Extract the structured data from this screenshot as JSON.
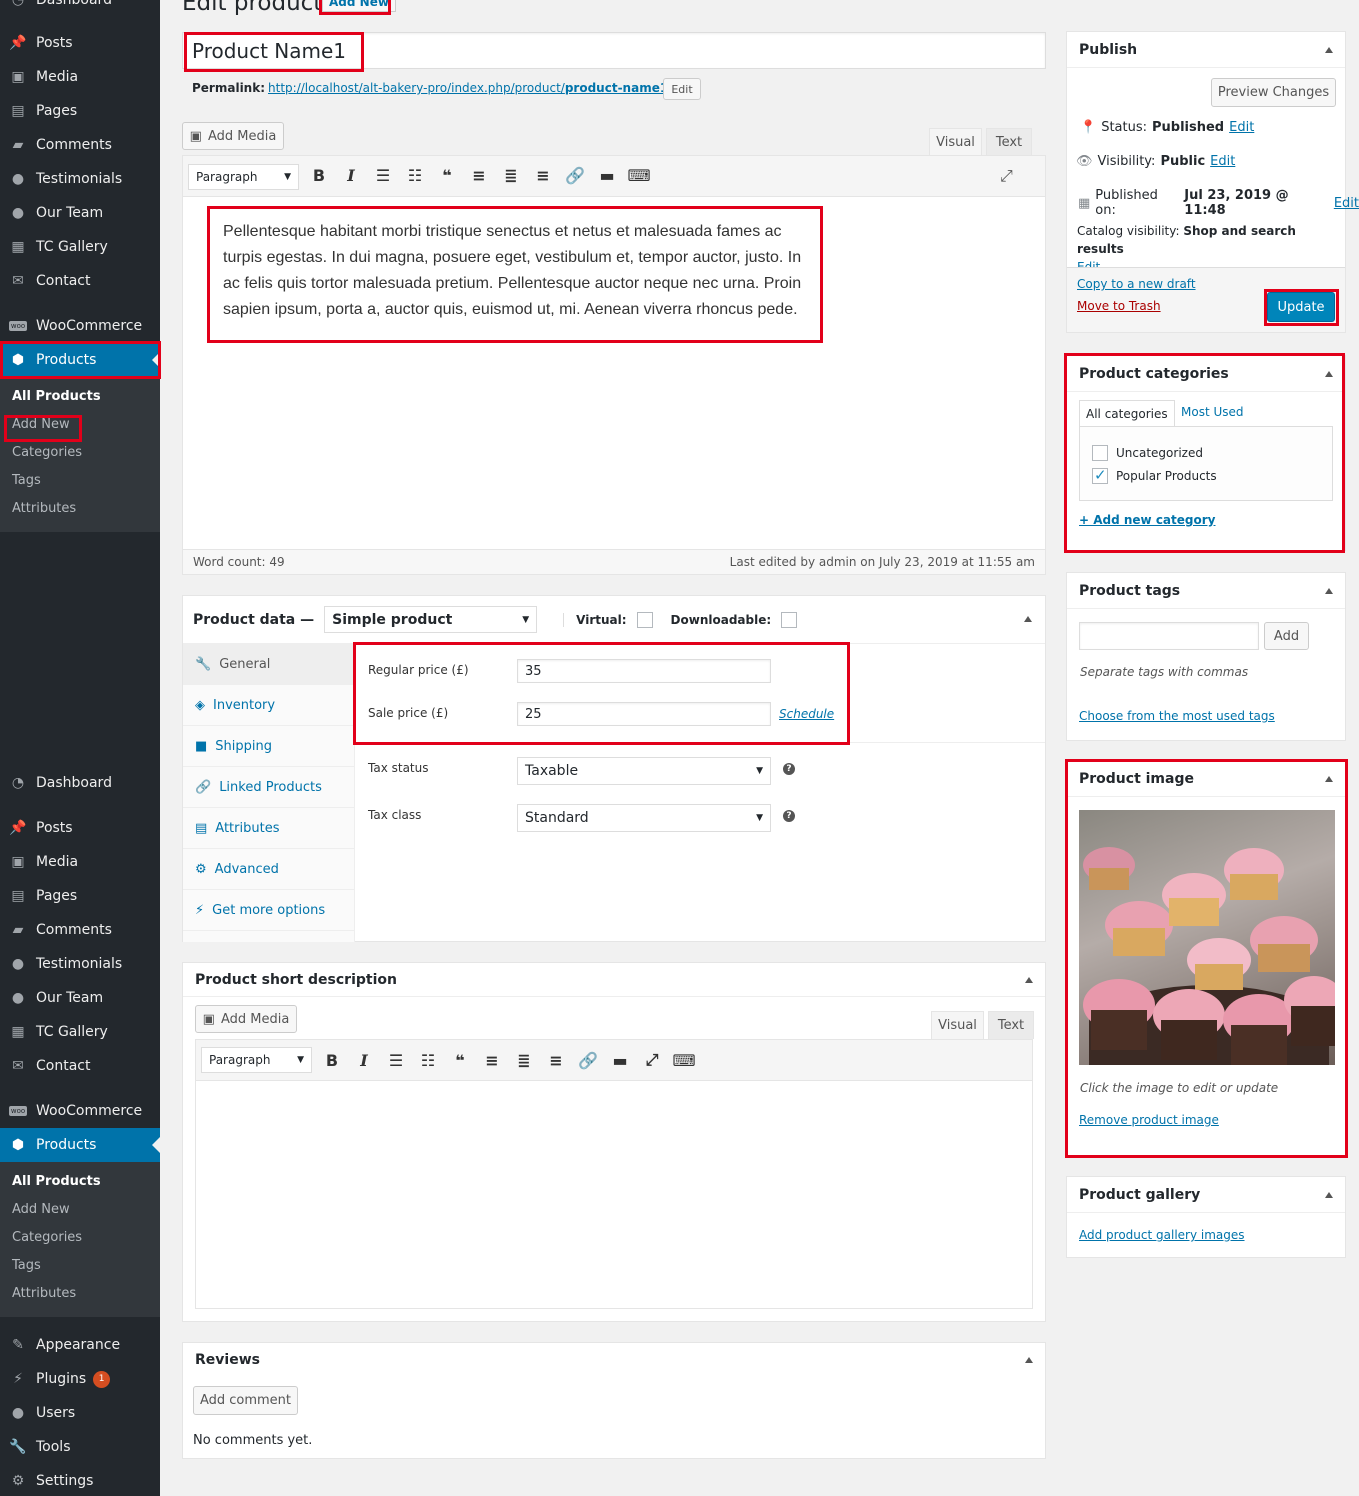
{
  "menu_top": [
    {
      "label": "Posts",
      "icon": "pin-icon"
    },
    {
      "label": "Media",
      "icon": "media-icon"
    },
    {
      "label": "Pages",
      "icon": "pages-icon"
    },
    {
      "label": "Comments",
      "icon": "comments-icon"
    },
    {
      "label": "Testimonials",
      "icon": "user-icon"
    },
    {
      "label": "Our Team",
      "icon": "user-icon"
    },
    {
      "label": "TC Gallery",
      "icon": "gallery-icon"
    },
    {
      "label": "Contact",
      "icon": "mail-icon"
    },
    {
      "label": "WooCommerce",
      "icon": "woo-icon"
    },
    {
      "label": "Products",
      "icon": "box-icon"
    }
  ],
  "submenu": [
    "All Products",
    "Add New",
    "Categories",
    "Tags",
    "Attributes"
  ],
  "menu_bottom": [
    {
      "label": "Dashboard"
    },
    {
      "label": "Posts"
    },
    {
      "label": "Media"
    },
    {
      "label": "Pages"
    },
    {
      "label": "Comments"
    },
    {
      "label": "Testimonials"
    },
    {
      "label": "Our Team"
    },
    {
      "label": "TC Gallery"
    },
    {
      "label": "Contact"
    },
    {
      "label": "WooCommerce"
    },
    {
      "label": "Products"
    }
  ],
  "menu_extra": [
    {
      "label": "Appearance"
    },
    {
      "label": "Plugins",
      "badge": "1"
    },
    {
      "label": "Users"
    },
    {
      "label": "Tools"
    },
    {
      "label": "Settings"
    }
  ],
  "header": {
    "title": "Edit product",
    "add_new": "Add New"
  },
  "product": {
    "name": "Product Name1",
    "permalink_label": "Permalink:",
    "permalink_base": "http://localhost/alt-bakery-pro/index.php/product/",
    "permalink_slug": "product-name1",
    "permalink_end": "/",
    "edit_btn": "Edit"
  },
  "editor": {
    "add_media": "Add Media",
    "tab_visual": "Visual",
    "tab_text": "Text",
    "format": "Paragraph",
    "content": "Pellentesque habitant morbi tristique senectus et netus et malesuada fames ac turpis egestas. In dui magna, posuere eget, vestibulum et, tempor auctor, justo. In ac felis quis tortor malesuada pretium. Pellentesque auctor neque nec urna. Proin sapien ipsum, porta a, auctor quis, euismod ut, mi. Aenean viverra rhoncus pede.",
    "word_count": "Word count: 49",
    "last_edited": "Last edited by admin on July 23, 2019 at 11:55 am"
  },
  "product_data": {
    "title": "Product data —",
    "type": "Simple product",
    "virtual": "Virtual:",
    "downloadable": "Downloadable:",
    "tabs": [
      "General",
      "Inventory",
      "Shipping",
      "Linked Products",
      "Attributes",
      "Advanced",
      "Get more options"
    ],
    "regular_label": "Regular price (£)",
    "regular_value": "35",
    "sale_label": "Sale price (£)",
    "sale_value": "25",
    "schedule": "Schedule",
    "tax_status_label": "Tax status",
    "tax_status": "Taxable",
    "tax_class_label": "Tax class",
    "tax_class": "Standard"
  },
  "short_desc": {
    "title": "Product short description",
    "add_media": "Add Media",
    "tab_visual": "Visual",
    "tab_text": "Text",
    "format": "Paragraph"
  },
  "reviews": {
    "title": "Reviews",
    "add_comment": "Add comment",
    "none": "No comments yet."
  },
  "publish": {
    "title": "Publish",
    "preview": "Preview Changes",
    "status_label": "Status:",
    "status": "Published",
    "visibility_label": "Visibility:",
    "visibility": "Public",
    "published_label": "Published on:",
    "published": "Jul 23, 2019 @ 11:48",
    "edit": "Edit",
    "catalog_label": "Catalog visibility:",
    "catalog": "Shop and search results",
    "copy": "Copy to a new draft",
    "trash": "Move to Trash",
    "update": "Update"
  },
  "categories": {
    "title": "Product categories",
    "tab_all": "All categories",
    "tab_most": "Most Used",
    "items": [
      "Uncategorized",
      "Popular Products"
    ],
    "add": "+ Add new category"
  },
  "tags": {
    "title": "Product tags",
    "add": "Add",
    "hint": "Separate tags with commas",
    "choose": "Choose from the most used tags"
  },
  "image": {
    "title": "Product image",
    "hint": "Click the image to edit or update",
    "remove": "Remove product image"
  },
  "gallery": {
    "title": "Product gallery",
    "add": "Add product gallery images"
  }
}
